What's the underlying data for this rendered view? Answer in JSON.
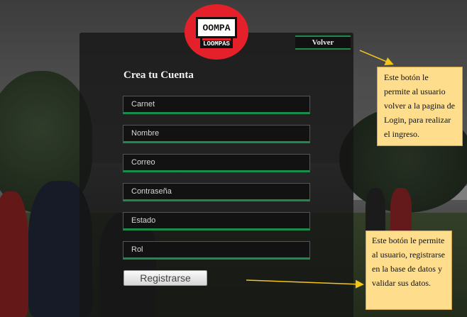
{
  "header": {
    "logo_text": "OOMPA",
    "logo_subtext": "LOOMPAS"
  },
  "nav": {
    "back_label": "Volver"
  },
  "form": {
    "title": "Crea tu Cuenta",
    "fields": [
      {
        "placeholder": "Carnet"
      },
      {
        "placeholder": "Nombre"
      },
      {
        "placeholder": "Correo"
      },
      {
        "placeholder": "Contraseña"
      },
      {
        "placeholder": "Estado"
      },
      {
        "placeholder": "Rol"
      }
    ],
    "submit_label": "Registrarse"
  },
  "annotations": {
    "back_note": "Este botón le permite al usuario volver a la pagina de Login, para realizar el ingreso.",
    "submit_note": "Este botón le permite al usuario, registrarse en la base de datos y validar sus datos."
  },
  "colors": {
    "accent_green": "#1c8c4c",
    "logo_red": "#e4202a",
    "callout_bg": "#fedd8d",
    "arrow": "#f5c518"
  }
}
